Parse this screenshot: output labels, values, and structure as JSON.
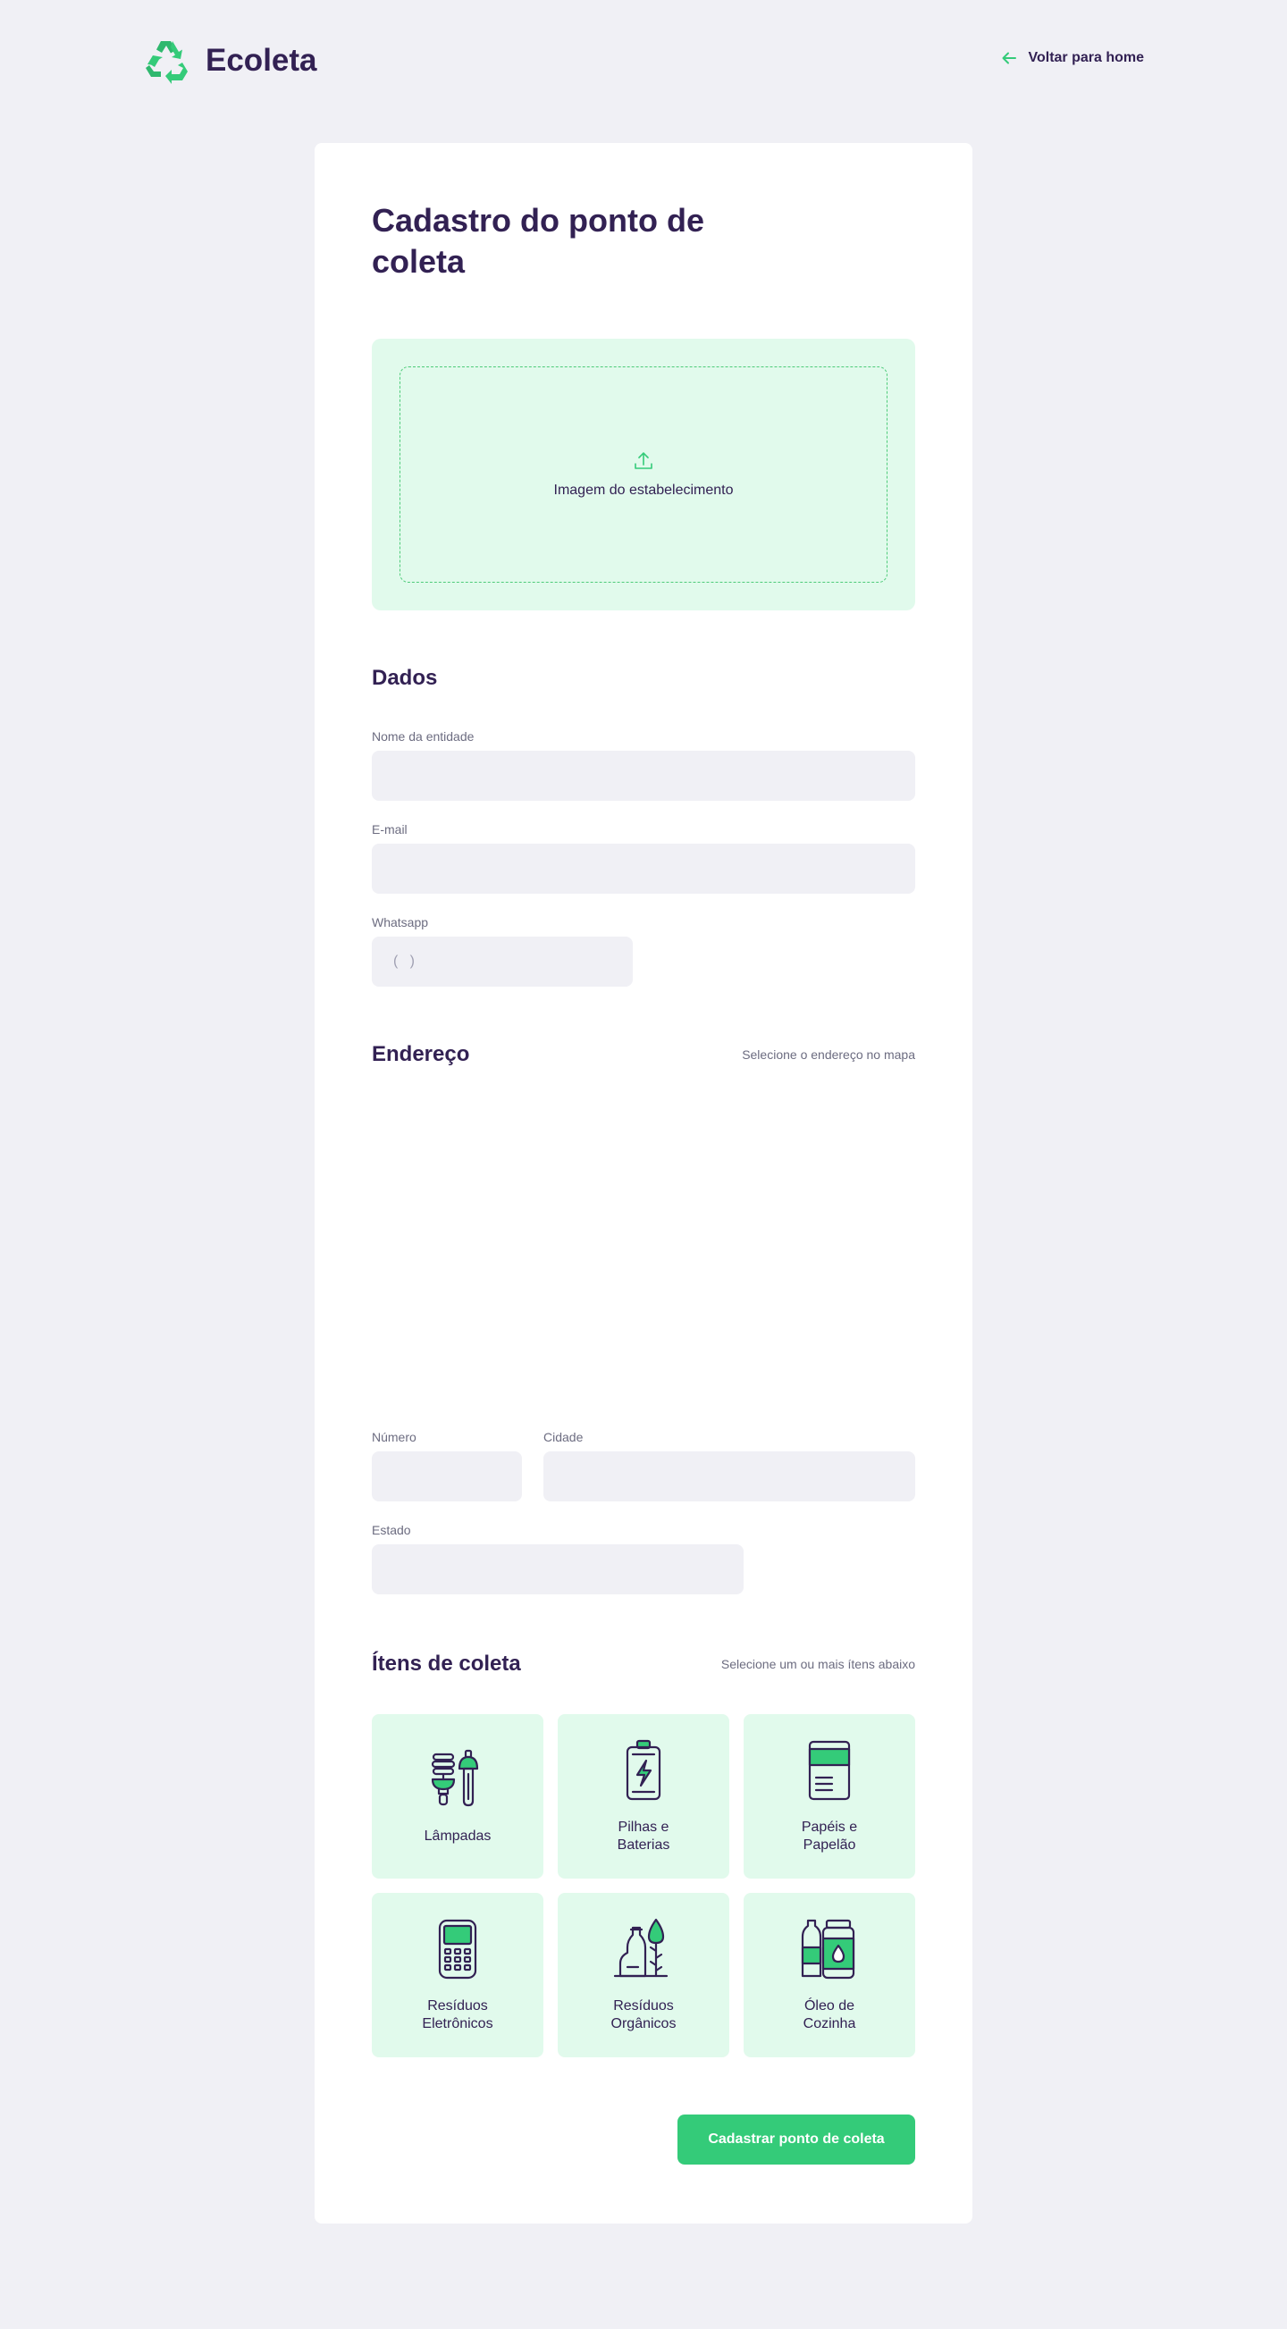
{
  "header": {
    "logo_text": "Ecoleta",
    "logo_icon": "recycle-icon",
    "back_label": "Voltar para home",
    "back_icon": "arrow-left-icon"
  },
  "form": {
    "title": "Cadastro do ponto de coleta",
    "dropzone_label": "Imagem do estabelecimento",
    "dados": {
      "title": "Dados",
      "name_label": "Nome da entidade",
      "email_label": "E-mail",
      "whatsapp_label": "Whatsapp",
      "whatsapp_placeholder": "(   )"
    },
    "endereco": {
      "title": "Endereço",
      "hint": "Selecione o endereço no mapa",
      "numero_label": "Número",
      "cidade_label": "Cidade",
      "estado_label": "Estado"
    },
    "itens": {
      "title": "Ítens de coleta",
      "hint": "Selecione um ou mais ítens abaixo",
      "list": [
        {
          "label": "Lâmpadas",
          "icon": "lamp-icon"
        },
        {
          "label": "Pilhas e Baterias",
          "icon": "battery-icon"
        },
        {
          "label": "Papéis e Papelão",
          "icon": "paper-icon"
        },
        {
          "label": "Resíduos Eletrônicos",
          "icon": "electronics-icon"
        },
        {
          "label": "Resíduos Orgânicos",
          "icon": "organic-icon"
        },
        {
          "label": "Óleo de Cozinha",
          "icon": "oil-icon"
        }
      ]
    },
    "submit_label": "Cadastrar ponto de coleta"
  },
  "colors": {
    "primary": "#34CB79",
    "title": "#322153",
    "text": "#6C6C80",
    "background": "#F0F0F5",
    "item_bg": "#E1FAEC"
  }
}
